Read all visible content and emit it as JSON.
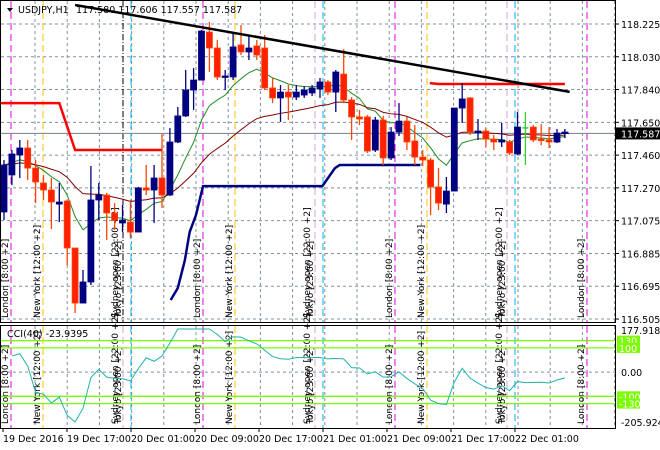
{
  "header": {
    "symbol": "USDJPY,H1",
    "ohlc": "117.580 117.606 117.557 117.587"
  },
  "current_price": "117.587",
  "price_axis": [
    "118.225",
    "118.030",
    "117.840",
    "117.650",
    "117.460",
    "117.270",
    "117.075",
    "116.885",
    "116.695",
    "116.505"
  ],
  "price_range": [
    116.505,
    118.225
  ],
  "time_axis": [
    "19 Dec 2016",
    "19 Dec 17:00",
    "20 Dec 01:00",
    "20 Dec 09:00",
    "20 Dec 17:00",
    "21 Dec 01:00",
    "21 Dec 09:00",
    "21 Dec 17:00",
    "22 Dec 01:00"
  ],
  "sessions": {
    "london": "London  [8:00 +2]",
    "newyork": "New York  [12:00 +2]",
    "sydney": "Sydney open  [22:00 +2]",
    "tokyo": "Tokyo  [23:00 +2]"
  },
  "cci": {
    "title": "CCI(40) -23.9395",
    "period": 40,
    "max_label": "177.9181",
    "min_label": "-205.9249",
    "range": [
      -205.9249,
      177.9181
    ],
    "levels": [
      "130",
      "100",
      "0.00",
      "-100",
      "-130"
    ]
  },
  "colors": {
    "bull": "#000080",
    "bear": "#ff2000",
    "bear_wick": "#ff4500",
    "ma_fast": "#228b22",
    "ma_slow": "#800000",
    "level": "#7cfc00",
    "cci": "#20b2aa",
    "london": "#e000e0",
    "newyork": "#ffc000",
    "sydney": "#d8a0d8",
    "tokyo": "#00b0f0"
  },
  "candles": [
    [
      117.129,
      117.432,
      117.082,
      117.403
    ],
    [
      117.345,
      117.49,
      117.286,
      117.467
    ],
    [
      117.461,
      117.549,
      117.327,
      117.502
    ],
    [
      117.502,
      117.549,
      117.315,
      117.385
    ],
    [
      117.385,
      117.432,
      117.181,
      117.304
    ],
    [
      117.298,
      117.345,
      117.199,
      117.257
    ],
    [
      117.257,
      117.327,
      117.03,
      117.187
    ],
    [
      117.175,
      117.298,
      117.07,
      117.187
    ],
    [
      117.193,
      117.199,
      116.82,
      116.919
    ],
    [
      116.919,
      116.919,
      116.54,
      116.598
    ],
    [
      116.598,
      116.791,
      116.598,
      116.721
    ],
    [
      116.721,
      117.397,
      116.703,
      117.199
    ],
    [
      117.199,
      117.298,
      117.082,
      117.228
    ],
    [
      117.228,
      117.24,
      116.966,
      117.123
    ],
    [
      117.123,
      117.181,
      117.024,
      117.082
    ],
    [
      117.065,
      117.17,
      117.012,
      117.082
    ],
    [
      117.07,
      117.199,
      116.977,
      117.012
    ],
    [
      117.012,
      117.275,
      117.012,
      117.269
    ],
    [
      117.269,
      117.403,
      117.228,
      117.257
    ],
    [
      117.257,
      117.403,
      117.065,
      117.327
    ],
    [
      117.327,
      117.584,
      117.152,
      117.228
    ],
    [
      117.228,
      117.619,
      117.222,
      117.537
    ],
    [
      117.537,
      117.741,
      117.531,
      117.689
    ],
    [
      117.689,
      117.957,
      117.683,
      117.84
    ],
    [
      117.84,
      117.968,
      117.724,
      117.898
    ],
    [
      117.898,
      118.19,
      117.898,
      118.184
    ],
    [
      118.178,
      118.237,
      117.945,
      118.085
    ],
    [
      118.085,
      118.132,
      117.898,
      117.916
    ],
    [
      117.916,
      117.957,
      117.84,
      117.922
    ],
    [
      117.916,
      118.178,
      117.898,
      118.091
    ],
    [
      118.103,
      118.219,
      118.044,
      118.062
    ],
    [
      118.062,
      118.161,
      118.015,
      118.085
    ],
    [
      118.097,
      118.132,
      118.015,
      118.044
    ],
    [
      118.085,
      118.161,
      117.84,
      117.852
    ],
    [
      117.852,
      117.91,
      117.764,
      117.794
    ],
    [
      117.794,
      117.869,
      117.654,
      117.828
    ],
    [
      117.828,
      117.869,
      117.665,
      117.799
    ],
    [
      117.799,
      117.869,
      117.782,
      117.828
    ],
    [
      117.811,
      117.863,
      117.794,
      117.84
    ],
    [
      117.823,
      117.869,
      117.805,
      117.852
    ],
    [
      117.846,
      117.91,
      117.794,
      117.887
    ],
    [
      117.887,
      117.898,
      117.811,
      117.828
    ],
    [
      117.828,
      117.957,
      117.712,
      117.945
    ],
    [
      117.933,
      118.079,
      117.764,
      117.782
    ],
    [
      117.782,
      117.799,
      117.549,
      117.683
    ],
    [
      117.683,
      117.724,
      117.636,
      117.671
    ],
    [
      117.683,
      117.694,
      117.473,
      117.484
    ],
    [
      117.49,
      117.683,
      117.479,
      117.665
    ],
    [
      117.665,
      117.689,
      117.403,
      117.444
    ],
    [
      117.444,
      117.624,
      117.432,
      117.595
    ],
    [
      117.595,
      117.764,
      117.572,
      117.659
    ],
    [
      117.659,
      117.683,
      117.49,
      117.537
    ],
    [
      117.543,
      117.636,
      117.403,
      117.449
    ],
    [
      117.449,
      117.49,
      117.397,
      117.432
    ],
    [
      117.432,
      117.444,
      117.111,
      117.275
    ],
    [
      117.275,
      117.385,
      117.14,
      117.181
    ],
    [
      117.175,
      117.333,
      117.123,
      117.251
    ],
    [
      117.251,
      117.735,
      117.251,
      117.735
    ],
    [
      117.735,
      117.881,
      117.648,
      117.788
    ],
    [
      117.794,
      117.799,
      117.578,
      117.595
    ],
    [
      117.595,
      117.671,
      117.549,
      117.601
    ],
    [
      117.601,
      117.619,
      117.508,
      117.554
    ],
    [
      117.554,
      117.578,
      117.49,
      117.537
    ],
    [
      117.537,
      117.648,
      117.508,
      117.549
    ],
    [
      117.537,
      117.549,
      117.461,
      117.473
    ],
    [
      117.467,
      117.712,
      117.461,
      117.624
    ],
    [
      117.619,
      117.712,
      117.403,
      117.619
    ],
    [
      117.624,
      117.636,
      117.537,
      117.549
    ],
    [
      117.554,
      117.642,
      117.519,
      117.549
    ],
    [
      117.549,
      117.624,
      117.502,
      117.537
    ],
    [
      117.537,
      117.613,
      117.531,
      117.589
    ],
    [
      117.589,
      117.613,
      117.56,
      117.595
    ]
  ],
  "lines": {
    "trendline": [
      [
        9,
        118.336
      ],
      [
        71.6,
        117.829
      ]
    ],
    "red_step_1": [
      [
        -0.5,
        117.764
      ],
      [
        7,
        117.764
      ],
      [
        9,
        117.49
      ],
      [
        20,
        117.49
      ]
    ],
    "red_step_2": [
      [
        53.9,
        117.88
      ],
      [
        55,
        117.875
      ],
      [
        71,
        117.875
      ]
    ],
    "blue_step": [
      [
        21.1,
        116.616
      ],
      [
        22,
        116.686
      ],
      [
        22.9,
        116.849
      ],
      [
        23.5,
        117.012
      ],
      [
        24.3,
        117.111
      ],
      [
        25.2,
        117.28
      ],
      [
        40.3,
        117.28
      ],
      [
        41.9,
        117.385
      ],
      [
        42.5,
        117.403
      ],
      [
        52.7,
        117.403
      ]
    ]
  }
}
